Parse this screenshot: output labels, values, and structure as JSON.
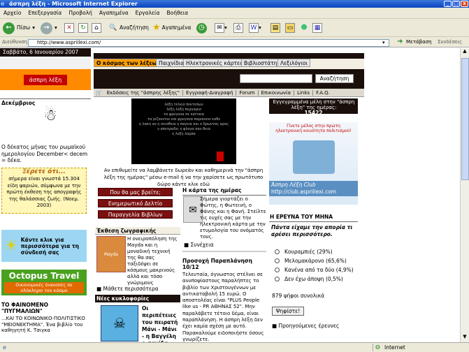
{
  "window": {
    "title": "άσπρη λέξη - Microsoft Internet Explorer"
  },
  "menu": [
    "Αρχείο",
    "Επεξεργασία",
    "Προβολή",
    "Αγαπημένα",
    "Εργαλεία",
    "Βοήθεια"
  ],
  "toolbar": {
    "back": "Πίσω",
    "search": "Αναζήτηση",
    "favorites": "Αγαπημένα"
  },
  "address": {
    "label": "Διεύθυνση",
    "url": "http://www.aspriilexi.com/",
    "go": "Μετάβαση",
    "links": "Συνδέσεις"
  },
  "status": {
    "zone": "Internet"
  },
  "site": {
    "date": "Σαββάτο, 6 Ιανουαρίου 2007",
    "logo": "άσπρη λέξη",
    "tabs": [
      "Ο κόσμος των λέξεων",
      "Παιχνίδια",
      "Ηλεκτρονικές κάρτες",
      "Βιβλιοστάτης",
      "Λεξιλόγιοι"
    ],
    "search_button": "Αναζήτηση",
    "links": [
      "Εκδόσεις της \"άσπρης λέξης\"",
      "Εγγραφή-Διαγραφή",
      "Forum",
      "Επικοινωνία",
      "Links",
      "F.A.Q."
    ],
    "members_title": "Εγγεγραμμένα μέλη στην \"άσπρη λέξη\" της ημέρας:",
    "members_count": "15422",
    "december_title": "Δεκέμβριος",
    "december_text": "Ο δέκατος μήνας του ρωμαϊκού ημερολογίου December< decem = δέκα.",
    "fish_title": "Ξέρετε ότι...",
    "fish_text": "σήμερα είναι γνωστά 15.304 είδη ψαριών, σύμφωνα με την πρώτη έκθεση της απογραφής της θαλάσσιας ζωής. (Νοεμ. 2003)",
    "click_text": "Κάντε κλικ για περισσότερα για τη σύνδεσή σας",
    "octopus_title": "Octopus Travel",
    "octopus_sub": "Οικονομικές διακοπές σε ολόκληρο τον κόσμο",
    "phenomenon_title": "ΤΟ ΦΑΙΝΟΜΕΝΟ \"ΠΥΓΜΑΛΙΩΝ\"",
    "phenomenon_text": "...ΚΑΙ ΤΟ ΚΟΙΝΩΝΙΚΟ-ΠΟΛΙΤΙΣΤΙΚΟ \"ΜΕΙΟΝΕΚΤΗΜΑ\". Ένα βιβλίο του καθηγητή Κ. Τσιγκα",
    "intro_caption": "Αν επιθυμείτε να λαμβάνετε δωρεάν και καθημερινά την \"άσπρη λέξη της ημέρας\" μέσω e-mail ή να την χαρίσετε ως πρωτότυπο δώρο κάντε κλικ εδώ",
    "red_buttons": [
      "Που θα μας βρείτε;",
      "Ενημερωτικό Δελτίο",
      "Παραγγελία Βιβλίων"
    ],
    "card_title": "Η κάρτα της ημέρας",
    "card_text": "Σήμερα γιορτάζει ο Φώτης, η Φωτεινή, ο Φάνης και η Φανή. Στείλτε τις ευχές σας με την ηλεκτρονική κάρτα με την ετυμολογία του ονόματός τους.",
    "card_more": "Συνέχεια",
    "exhibition_title": "Έκθεση ζωγραφικής",
    "exhibition_text": "Η ονειροπόληση της Mayda και η μοναδική τεχνική της θα σας ταξιδέψει σε κόσμους μακρινούς αλλά και τόσο γνώριμους",
    "exhibition_more": "Μάθετε περισσότερα",
    "correction_title": "Προσοχή Παραπλάνηση 10/12",
    "correction_text": "Τελευταία, όγνωστος στέλνει σε ανυποψίαστους παραλήπτες το βιβλίο των Χριστουγέννων με αντικαταβολή 15 ευρώ. Ο αποστολέας είναι \"PLUS People like us - PR ΑΘΗΝΑΣ 52\". Μην παραλάβετε τέτοιο δέμα, είναι παραπλάνηση. Η άσπρη λέξη δεν έχει καμία σχέση με αυτό. Παρακαλούμε ειδοποιήστε όσους γνωρίζετε.",
    "releases_title": "Νέες κυκλοφορίες",
    "releases_text": "Οι περιπέτειες του πειρατή Μάνι - Μάνι - η Βαγγέλη ο σανίδα",
    "club_title": "Γίνετε μέλος στην πρώτη ηλεκτρονική κοινότητα πολιτισμού!",
    "club_caption": "Άσπρη Λέξη Club",
    "club_url": "http://club.aspriilexi.com",
    "poll_title": "Η ΕΡΕΥΝΑ ΤΟΥ ΜΗΝΑ",
    "poll_question": "Πάντα είχαμε την απορία τι αρέσει περισσότερο.",
    "poll_options": [
      "Κουραμπιές (29%)",
      "Μελομακάρονο (65,6%)",
      "Κανένα από τα δύο (4,9%)",
      "Δεν έχω άποψη (0,5%)"
    ],
    "poll_total": "879  ψήφοι συνολικά",
    "poll_vote": "Ψηφίστε!",
    "poll_prev": "Προηγούμενες έρευνες",
    "poem_lines": [
      "λέξη τέλειο πεκτεπων",
      "λέξη λέξη περγαρισ",
      "τα φρυγανα σε καιταια",
      "τα ριζουνται και φρυγανα παραυσια καθε",
      "η λακη αν η σεισθεια η παγεια και ο δρωντας αρος",
      "ν αποτραδει η φλογα σαν θεια",
      "η λεξη λαμπα"
    ]
  }
}
